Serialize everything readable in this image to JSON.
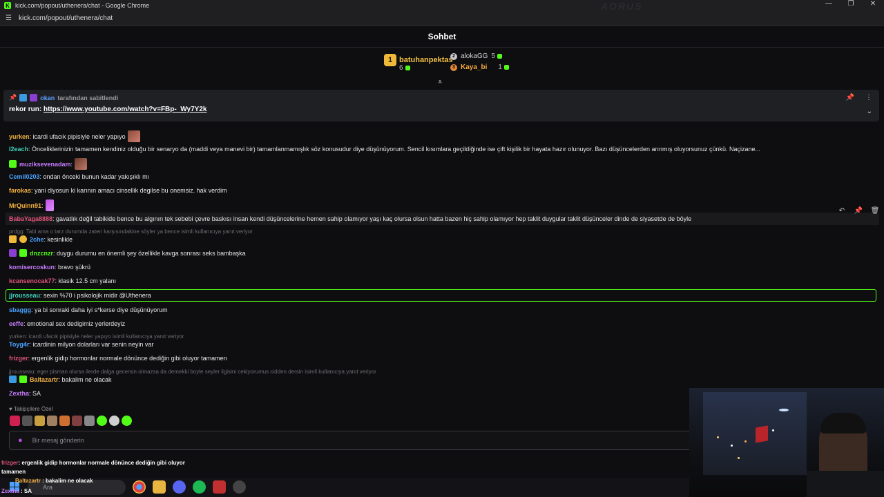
{
  "browser": {
    "title": "kick.com/popout/uthenera/chat - Google Chrome",
    "url": "kick.com/popout/uthenera/chat",
    "watermark": "AORUS"
  },
  "chat": {
    "title": "Sohbet",
    "leaderboard": {
      "first": {
        "name": "batuhanpektas",
        "count": "6",
        "rank": "1"
      },
      "second": {
        "name": "alokaGG",
        "count": "5"
      },
      "third": {
        "name": "Kaya_bi",
        "count": "1"
      }
    },
    "pinned": {
      "pinned_by": "okan",
      "pinned_text": "tarafından sabitlendi",
      "message_prefix": "rekor run: ",
      "link": "https://www.youtube.com/watch?v=FBp-_Wy7Y2k"
    },
    "messages": [
      {
        "user": "yurken",
        "color": "#f5b342",
        "text": ": icardi ufacık pipisiyle neler yapıyo"
      },
      {
        "user": "I2each",
        "color": "#3fd0b8",
        "text": ": Önceliklerinizin tamamen kendiniz olduğu bir senaryo da (maddi veya manevi bir) tamamlanmamışlık söz konusudur diye düşünüyorum. Sencil kısımlara geçildiğinde ise çift kişilik bir hayata hazır olunuyor. Bazı düşüncelerden arınmış oluyorsunuz çünkü. Naçizane..."
      },
      {
        "user": "muziksevenadam",
        "color": "#c77dff",
        "text": ":"
      },
      {
        "user": "Cemil0203",
        "color": "#4aa3ff",
        "text": ": ondan önceki bunun kadar yakışıklı mı"
      },
      {
        "user": "farokas",
        "color": "#f5b342",
        "text": ": yani diyosun ki karının amacı cinsellik degilse bu onemsiz. hak verdim"
      },
      {
        "user": "MrQuinn91",
        "color": "#f5b342",
        "text": ":"
      },
      {
        "user": "BabaYaga8888",
        "color": "#e0537a",
        "text": ": gavatlık değil tabikide bence bu algının tek sebebi çevre baskısı insan kendi düşüncelerine hemen sahip olamıyor yaşı kaç olursa olsun hatta bazen hiç sahip olamıyor hep taklit duygular taklit düşünceler dinde de siyasetde de böyle"
      },
      {
        "user": "2che",
        "color": "#4aa3ff",
        "text": ": kesinlikle"
      },
      {
        "user": "dnzcnzr",
        "color": "#53fc18",
        "text": ": duygu durumu en önemli şey özellikle kavga sonrası seks bambaşka"
      },
      {
        "user": "komisercoskun",
        "color": "#c77dff",
        "text": ": bravo şükrü"
      },
      {
        "user": "kcansenocak77",
        "color": "#e0537a",
        "text": ": klasik 12.5 cm yalanı"
      },
      {
        "user": "jjrousseau",
        "color": "#3fd0b8",
        "text": ": sexin %70 i psikolojik midir @Uthenera"
      },
      {
        "user": "sbaggg",
        "color": "#4aa3ff",
        "text": ": ya bi sonraki daha iyi s*kerse diye düşünüyorum"
      },
      {
        "user": "eeffe",
        "color": "#c77dff",
        "text": ": emotional sex dedigimiz yerlerdeyiz"
      },
      {
        "user": "Toyg4r",
        "color": "#4aa3ff",
        "text": ": icardinin milyon dolarları var senin neyin var"
      },
      {
        "user": "frizger",
        "color": "#e0537a",
        "text": ": ergenlik gidip hormonlar normale dönünce dediğin gibi oluyor tamamen"
      },
      {
        "user": "Baltazartr",
        "color": "#f5b342",
        "text": ": bakalim ne olacak"
      },
      {
        "user": "Zextha",
        "color": "#c77dff",
        "text": ": SA"
      }
    ],
    "replies": [
      "prdgg: Tabi ama o tarz durumda zaten karşısındakine söyler ya bence  isimli kullanıcıya yanıt veriyor",
      "yurken: icardi ufacık pipisiyle neler yapıyo       isimli kullanıcıya yanıt veriyor",
      "jjrousseau: eger pisman olursa ilerde dalga gecersin olmazsa da demekki boyle seyler ilgisini cekiyorumus cidden dersin isimli kullanıcıya yanıt veriyor"
    ],
    "followers_label": "Takipçilere Özel",
    "input_placeholder": "Bir mesaj gönderin"
  },
  "overlay": {
    "line1_user": "frizger",
    "line1_text": ": ergenlik gidip hormonlar normale dönünce dediğin gibi oluyor",
    "line2": "tamamen",
    "line3_user": "Baltazartr",
    "line3_text": " : bakalim ne olacak",
    "line4_user": "Zextha",
    "line4_text": " : SA"
  },
  "taskbar": {
    "search_placeholder": "Ara"
  },
  "colors": {
    "accent": "#53fc18",
    "background": "#0e0e10",
    "pinned_bg": "#1f2024"
  }
}
